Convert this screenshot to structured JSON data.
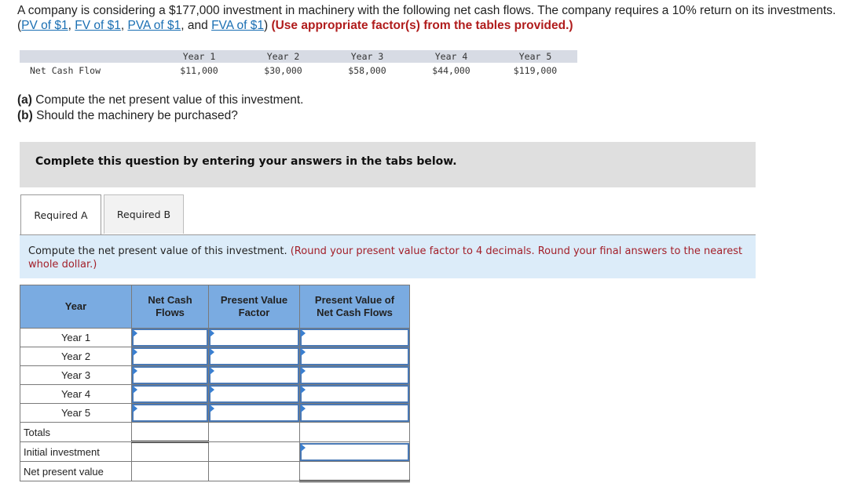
{
  "intro": {
    "text_before": "A company is considering a $177,000 investment in machinery with the following net cash flows. The company requires a 10% return on its investments. (",
    "links": [
      "PV of $1",
      "FV of $1",
      "PVA of $1",
      "FVA of $1"
    ],
    "sep1": ", ",
    "sep2": ", ",
    "sep3": ", and ",
    "text_after": ") ",
    "hint": "(Use appropriate factor(s) from the tables provided.)"
  },
  "cash_flow_table": {
    "row_label": "Net Cash Flow",
    "headers": [
      "Year 1",
      "Year 2",
      "Year 3",
      "Year 4",
      "Year 5"
    ],
    "values": [
      "$11,000",
      "$30,000",
      "$58,000",
      "$44,000",
      "$119,000"
    ]
  },
  "questions": {
    "a_label": "(a)",
    "a_text": " Compute the net present value of this investment.",
    "b_label": "(b)",
    "b_text": " Should the machinery be purchased?"
  },
  "banner": "Complete this question by entering your answers in the tabs below.",
  "tabs": [
    {
      "label": "Required A",
      "active": true
    },
    {
      "label": "Required B",
      "active": false
    }
  ],
  "instruction": {
    "text": "Compute the net present value of this investment. ",
    "hint": "(Round your present value factor to 4 decimals. Round your final answers to the nearest whole dollar.)"
  },
  "npv_table": {
    "headers": [
      "Year",
      "Net Cash Flows",
      "Present Value Factor",
      "Present Value of Net Cash Flows"
    ],
    "year_rows": [
      "Year 1",
      "Year 2",
      "Year 3",
      "Year 4",
      "Year 5"
    ],
    "totals_label": "Totals",
    "initial_investment_label": "Initial investment",
    "npv_label": "Net present value",
    "inputs": {
      "net_cash_flows": [
        "",
        "",
        "",
        "",
        ""
      ],
      "pv_factor": [
        "",
        "",
        "",
        "",
        ""
      ],
      "pv_cash_flows": [
        "",
        "",
        "",
        "",
        ""
      ],
      "initial_investment": ""
    }
  },
  "colors": {
    "link": "#1a6fb3",
    "hint_red": "#b01c1c",
    "header_blue": "#7aabe1",
    "instruction_bg": "#dcecf9",
    "banner_bg": "#dfdfdf",
    "input_border": "#4a79b5"
  }
}
